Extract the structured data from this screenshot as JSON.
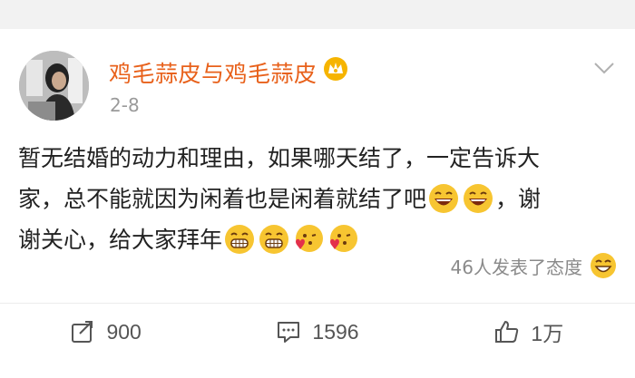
{
  "post": {
    "username": "鸡毛蒜皮与鸡毛蒜皮",
    "time": "2-8",
    "content_line1": "暂无结婚的动力和理由，如果哪天结了，一定告诉大",
    "content_line2": "家，总不能就因为闲着也是闲着就结了吧",
    "content_line2_end": "，谢",
    "content_line3": "谢关心，给大家拜年",
    "attitude_text": "46人发表了态度"
  },
  "actions": {
    "repost_count": "900",
    "comment_count": "1596",
    "like_count": "1万"
  },
  "colors": {
    "username": "#e8611b",
    "background": "#f2f2f2",
    "emoji_yellow": "#f7c531"
  },
  "icons": [
    "vip-crown-icon",
    "chevron-down-icon",
    "grin-emoji-icon",
    "laugh-emoji-icon",
    "kiss-heart-emoji-icon",
    "smile-emoji-icon",
    "repost-icon",
    "comment-icon",
    "like-icon"
  ]
}
